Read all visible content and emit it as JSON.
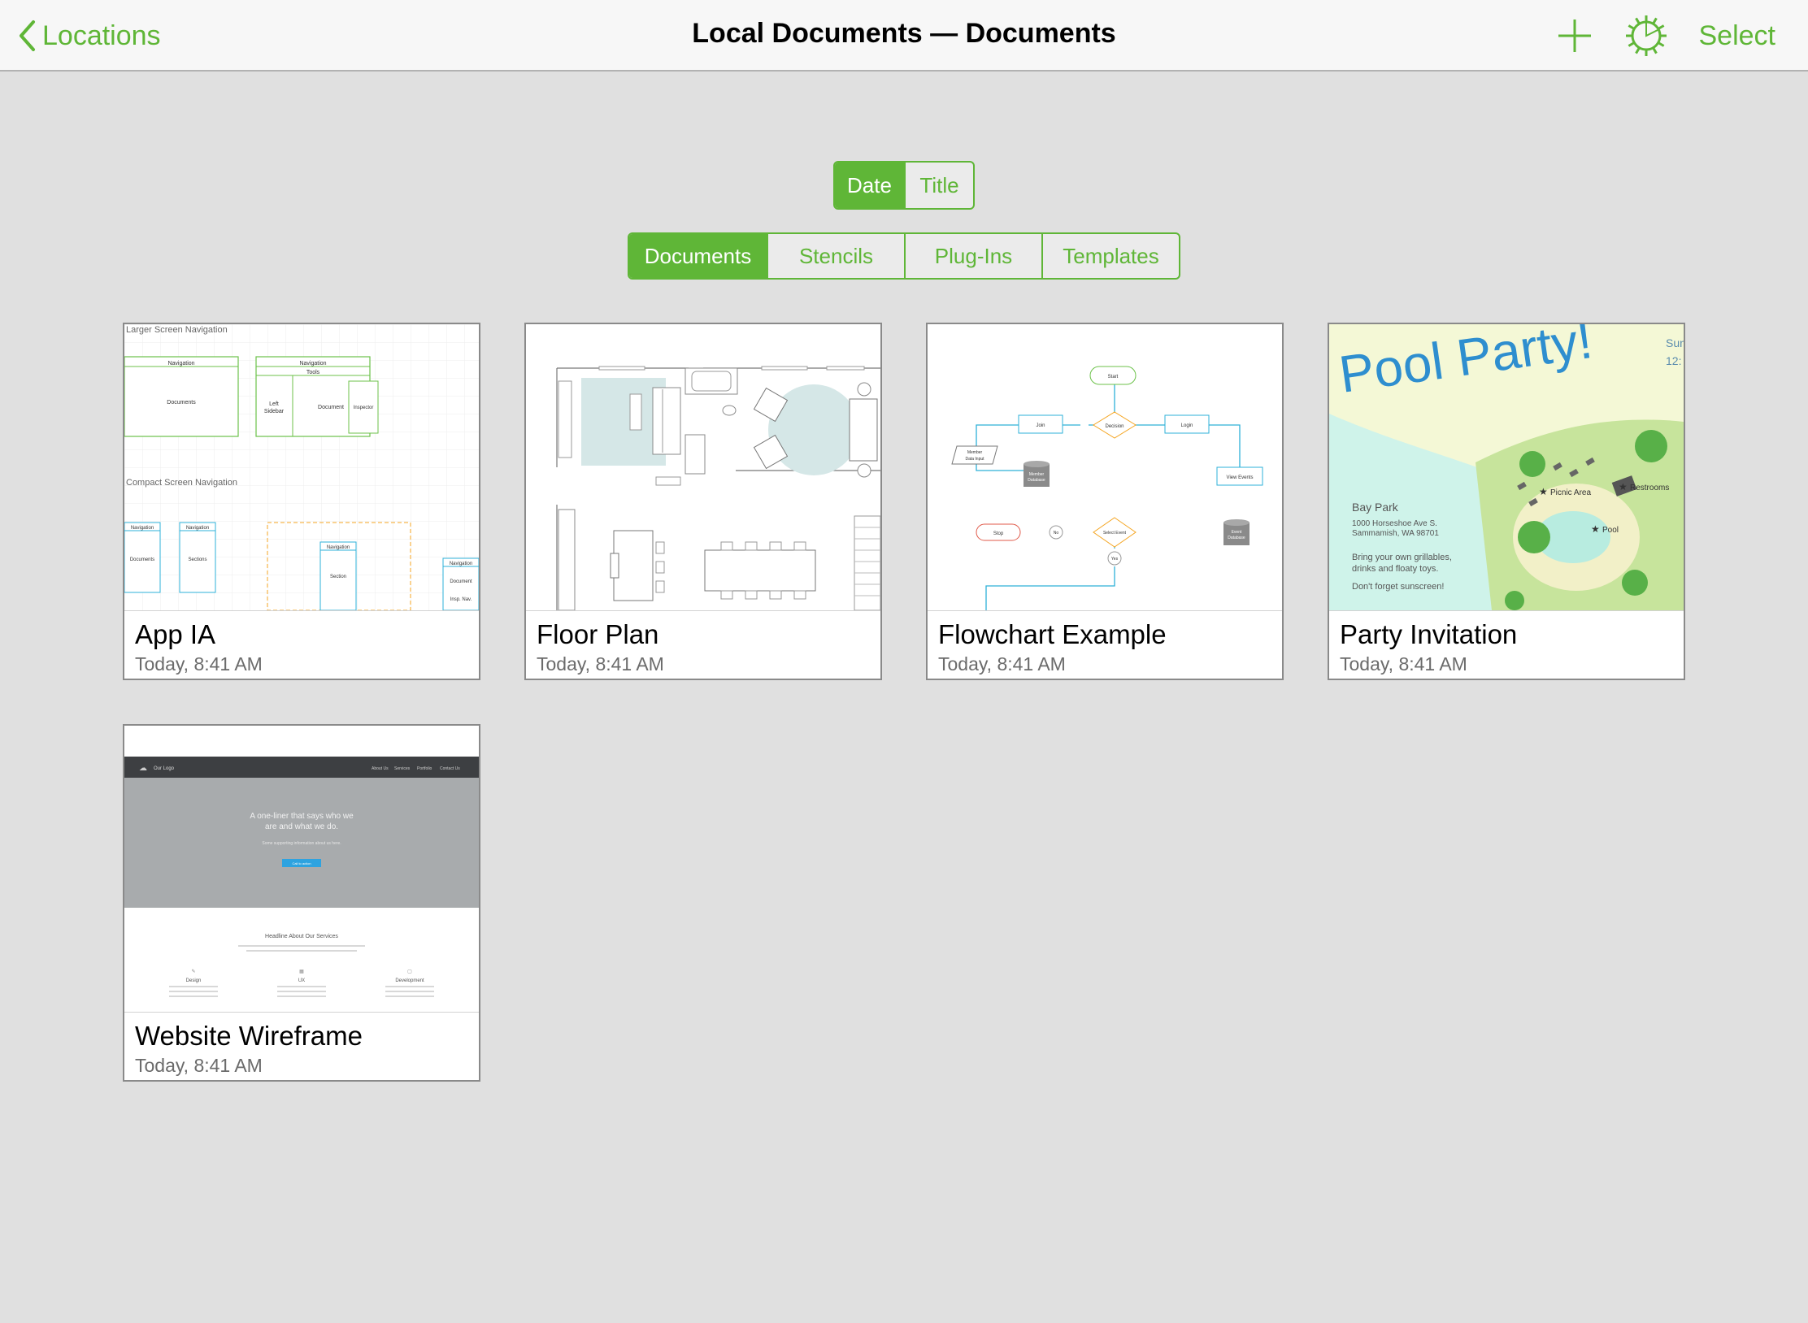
{
  "navbar": {
    "back_label": "Locations",
    "title": "Local Documents — Documents",
    "select_label": "Select",
    "accent_color": "#5fb637"
  },
  "sort_control": {
    "options": [
      "Date",
      "Title"
    ],
    "selected": "Date"
  },
  "type_control": {
    "options": [
      "Documents",
      "Stencils",
      "Plug-Ins",
      "Templates"
    ],
    "selected": "Documents"
  },
  "documents": [
    {
      "name": "App IA",
      "date": "Today, 8:41 AM",
      "thumb": {
        "heading_large": "Larger Screen Navigation",
        "heading_compact": "Compact Screen Navigation",
        "navigation": "Navigation",
        "tools": "Tools",
        "documents": "Documents",
        "left_sidebar_1": "Left",
        "left_sidebar_2": "Sidebar",
        "document": "Document",
        "inspector": "Inspector",
        "sections": "Sections",
        "section": "Section",
        "insp_nav": "Insp. Nav."
      }
    },
    {
      "name": "Floor Plan",
      "date": "Today, 8:41 AM"
    },
    {
      "name": "Flowchart Example",
      "date": "Today, 8:41 AM",
      "thumb": {
        "start": "Start",
        "join": "Join",
        "decision": "Decision",
        "login": "Login",
        "member_data_1": "Member",
        "member_data_2": "Data Input",
        "member_db_1": "Member",
        "member_db_2": "Database",
        "view_events": "View Events",
        "stop": "Stop",
        "no": "No",
        "select_event": "Select Event",
        "yes": "Yes",
        "event_db_1": "Event",
        "event_db_2": "Database"
      }
    },
    {
      "name": "Party Invitation",
      "date": "Today, 8:41 AM",
      "thumb": {
        "headline": "Pool Party!",
        "date_fragment": "Sun",
        "time_fragment": "12:",
        "park": "Bay Park",
        "address_1": "1000 Horseshoe Ave S.",
        "address_2": "Sammamish, WA 98701",
        "bring_1": "Bring your own grillables,",
        "bring_2": "drinks and floaty toys.",
        "sunscreen": "Don't forget sunscreen!",
        "picnic_area": "Picnic Area",
        "restrooms": "Restrooms",
        "pool": "Pool"
      }
    },
    {
      "name": "Website Wireframe",
      "date": "Today, 8:41 AM",
      "thumb": {
        "logo": "Our Logo",
        "nav_1": "About Us",
        "nav_2": "Services",
        "nav_3": "Portfolio",
        "nav_4": "Contact Us",
        "hero_1": "A one-liner that says who we",
        "hero_2": "are and what we do.",
        "hero_sub": "Some supporting information about us here.",
        "cta": "Call to action",
        "services_heading": "Headline About Our Services",
        "service_1": "Design",
        "service_2": "UX",
        "service_3": "Development"
      }
    }
  ]
}
